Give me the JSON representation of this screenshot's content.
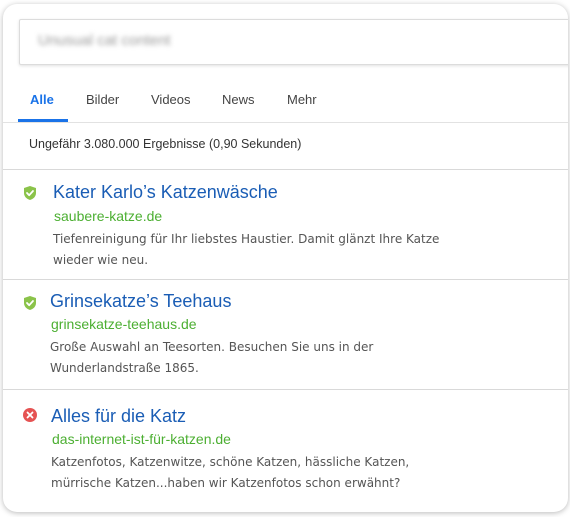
{
  "search": {
    "query": "Unusual cat content"
  },
  "tabs": [
    {
      "label": "Alle",
      "active": true
    },
    {
      "label": "Bilder"
    },
    {
      "label": "Videos"
    },
    {
      "label": "News"
    },
    {
      "label": "Mehr"
    }
  ],
  "stats": "Ungefähr 3.080.000 Ergebnisse (0,90 Sekunden)",
  "colors": {
    "accent": "#1a73e8",
    "title": "#1a5db5",
    "url": "#4caf32",
    "safe": "#8bc34a",
    "unsafe": "#e55353"
  },
  "results": [
    {
      "status": "shield-check-icon",
      "title": "Kater Karlo’s Katzenwäsche",
      "url": "saubere-katze.de",
      "desc1": "Tiefenreinigung für Ihr liebstes Haustier. Damit glänzt Ihre Katze",
      "desc2": "wieder wie neu."
    },
    {
      "status": "shield-check-icon",
      "title": "Grinsekatze’s Teehaus",
      "url": "grinsekatze-teehaus.de",
      "desc1": "Große Auswahl an Teesorten. Besuchen Sie uns in der",
      "desc2": "Wunderlandstraße 1865."
    },
    {
      "status": "warning-x-icon",
      "title": "Alles für die Katz",
      "url": "das-internet-ist-für-katzen.de",
      "desc1": "Katzenfotos, Katzenwitze, schöne Katzen, hässliche Katzen,",
      "desc2": "mürrische Katzen...haben wir Katzenfotos schon erwähnt?"
    }
  ]
}
